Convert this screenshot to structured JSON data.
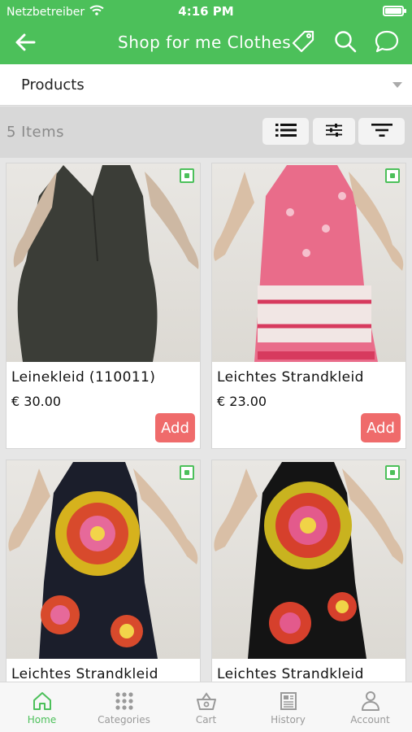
{
  "status_bar": {
    "carrier": "Netzbetreiber",
    "time": "4:16 PM"
  },
  "header": {
    "title": "Shop for me Clothes"
  },
  "category_select": {
    "selected": "Products"
  },
  "toolbar": {
    "items_count": "5 Items"
  },
  "products": [
    {
      "name": "Leinekleid (110011)",
      "price": "€ 30.00",
      "add_label": "Add"
    },
    {
      "name": "Leichtes Strandkleid",
      "price": "€ 23.00",
      "add_label": "Add"
    },
    {
      "name": "Leichtes Strandkleid",
      "price": "",
      "add_label": ""
    },
    {
      "name": "Leichtes Strandkleid",
      "price": "",
      "add_label": ""
    }
  ],
  "tabs": [
    {
      "label": "Home",
      "icon": "home-icon",
      "active": true
    },
    {
      "label": "Categories",
      "icon": "grid-icon",
      "active": false
    },
    {
      "label": "Cart",
      "icon": "basket-icon",
      "active": false
    },
    {
      "label": "History",
      "icon": "newspaper-icon",
      "active": false
    },
    {
      "label": "Account",
      "icon": "user-icon",
      "active": false
    }
  ],
  "colors": {
    "accent": "#4cc05a",
    "add_button": "#ef6b6b",
    "toolbar_bg": "#d8d8d8"
  }
}
